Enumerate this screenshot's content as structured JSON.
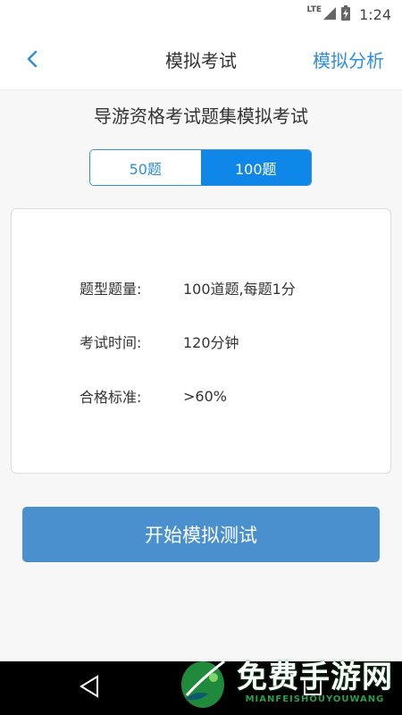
{
  "status_bar": {
    "network": "LTE",
    "time": "1:24"
  },
  "header": {
    "title": "模拟考试",
    "action_label": "模拟分析",
    "accent_color": "#2f8fd8"
  },
  "exam": {
    "title": "导游资格考试题集模拟考试",
    "tabs": [
      {
        "label": "50题",
        "selected": false
      },
      {
        "label": "100题",
        "selected": true
      }
    ],
    "details": [
      {
        "label": "题型题量:",
        "value": "100道题,每题1分"
      },
      {
        "label": "考试时间:",
        "value": "120分钟"
      },
      {
        "label": "合格标准:",
        "value": ">60%"
      }
    ],
    "start_button": "开始模拟测试"
  },
  "nav_bar": {
    "icons": [
      "back-triangle-icon",
      "home-circle-icon",
      "recents-square-icon"
    ]
  },
  "watermark": {
    "cn": "免费手游网",
    "en": "MIANFEISHOUYOUWANG"
  }
}
